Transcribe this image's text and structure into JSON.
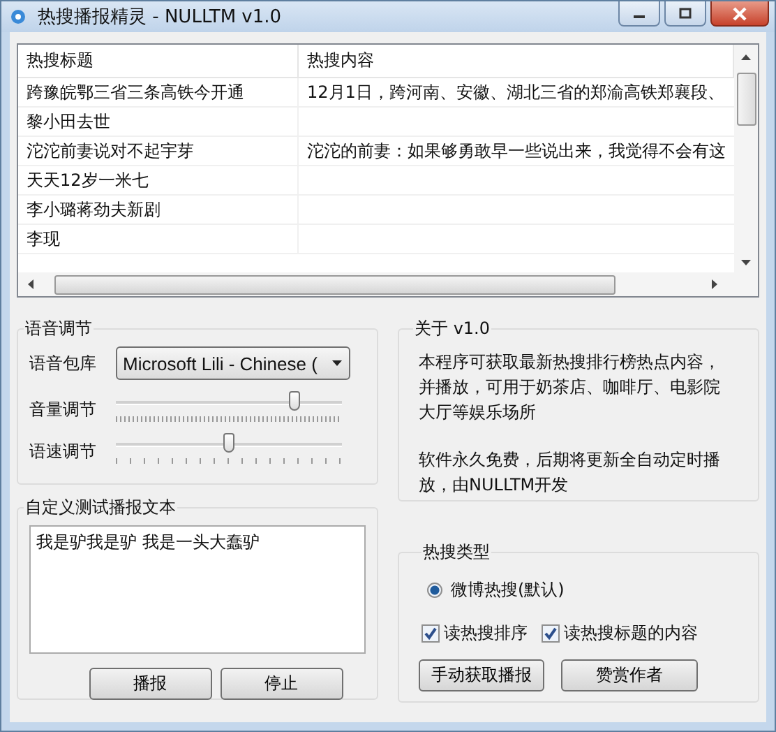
{
  "window": {
    "title": "热搜播报精灵 - NULLTM v1.0"
  },
  "hot_list": {
    "columns": [
      "热搜标题",
      "热搜内容"
    ],
    "rows": [
      [
        "跨豫皖鄂三省三条高铁今开通",
        "12月1日，跨河南、安徽、湖北三省的郑渝高铁郑襄段、"
      ],
      [
        "黎小田去世",
        ""
      ],
      [
        "沱沱前妻说对不起宇芽",
        "沱沱的前妻：如果够勇敢早一些说出来，我觉得不会有这"
      ],
      [
        "天天12岁一米七",
        ""
      ],
      [
        "李小璐蒋劲夫新剧",
        ""
      ],
      [
        "李现",
        ""
      ]
    ]
  },
  "voice": {
    "title": "语音调节",
    "voice_label": "语音包库",
    "voice_value": "Microsoft Lili - Chinese (",
    "sliders": [
      {
        "label": "音量调节",
        "level": 0.79
      },
      {
        "label": "语速调节",
        "level": 0.5
      }
    ]
  },
  "custom_text": {
    "title": "自定义测试播报文本",
    "value": "我是驴我是驴 我是一头大蠢驴",
    "buttons": [
      "播报",
      "停止"
    ]
  },
  "about": {
    "title": "关于 v1.0",
    "paragraphs": [
      "本程序可获取最新热搜排行榜热点内容，并播放，可用于奶茶店、咖啡厅、电影院大厅等娱乐场所",
      "软件永久免费，后期将更新全自动定时播放，由NULLTM开发"
    ]
  },
  "hot_type": {
    "title": "热搜类型",
    "options": [
      {
        "label": "微博热搜(默认)",
        "selected": true
      }
    ],
    "checkboxes": [
      {
        "label": "读热搜排序",
        "checked": true
      },
      {
        "label": "读热搜标题的内容",
        "checked": true
      }
    ],
    "buttons": [
      "手动获取播报",
      "赞赏作者"
    ]
  }
}
